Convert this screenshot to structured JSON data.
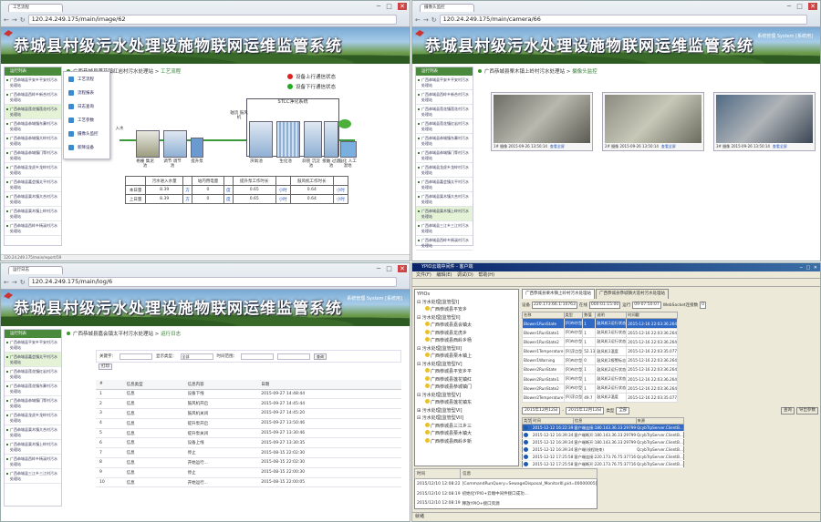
{
  "q1": {
    "tab_title": "工艺流程",
    "url": "120.24.249.175/main/image/62",
    "banner_title": "恭城县村级污水处理设施物联网运维监管系统",
    "side_head": "运行列表",
    "side_items": [
      "广西恭城县平安乡平安村污水处理站",
      "广西恭城县西岭乡新合村污水处理站",
      "广西恭城县莲花镇莲花村污水处理站",
      "广西恭城县恭城镇东寨村污水处理站",
      "广西恭城县恭城镇大岭村污水处理站",
      "广西恭城县恭城镇门等村污水处理站",
      "广西恭城县龙虎乡龙岭村污水处理站",
      "广西恭城县嘉会镇太平村污水处理站",
      "广西恭城县栗木镇大合村污水处理站",
      "广西恭城县栗木镇上岭村污水处理站",
      "广西恭城县西岭乡杨溪村污水处理站"
    ],
    "crumb_site": "广西恭城县莲花镇红岩村污水处理站",
    "crumb_sep": " > ",
    "crumb_page": "工艺流程",
    "menu": [
      "工艺流程",
      "流程报表",
      "日志查询",
      "工艺参数",
      "摄像头监控",
      "新降设备"
    ],
    "legend_up": "设备上行通信状态",
    "legend_down": "设备下行通信状态",
    "stcc": "STCC净化系统",
    "blower": "轴流 鼓风机",
    "inlet": "入水",
    "labels": [
      "格栅 集泥池",
      "调节 调节池",
      "提升泵",
      "厌氧池",
      "生化池",
      "斜管 沉淀池",
      "接触 过滤池",
      "强化 人工湿地"
    ],
    "table": {
      "head": [
        "",
        "污水进入水量",
        "",
        "站内用电量",
        "",
        "提升泵工作时长",
        "",
        "鼓风机工作时长",
        ""
      ],
      "rows": [
        [
          "本日量",
          "8.39",
          "方",
          "0",
          "度",
          "0.65",
          "小时",
          "0.64",
          "小时"
        ],
        [
          "上日量",
          "8.39",
          "方",
          "0",
          "度",
          "0.65",
          "小时",
          "0.64",
          "小时"
        ]
      ]
    },
    "status": "120.24.249.175/main/report/59"
  },
  "q2": {
    "tab_title": "摄像头监控",
    "url": "120.24.249.175/main/camera/66",
    "banner_title": "恭城县村级污水处理设施物联网运维监管系统",
    "links": "系统管理    System [系统用]",
    "side_head": "运行列表",
    "side_items": [
      "广西恭城县平安乡平安村污水处理站",
      "广西恭城县西岭乡新合村污水处理站",
      "广西恭城县莲花镇莲花村污水处理站",
      "广西恭城县莲花镇红岩村污水处理站",
      "广西恭城县恭城镇东寨村污水处理站",
      "广西恭城县恭城镇门等村污水处理站",
      "广西恭城县龙虎乡龙岭村污水处理站",
      "广西恭城县嘉会镇太平村污水处理站",
      "广西恭城县栗木镇大合村污水处理站",
      "广西恭城县栗木镇上岭村污水处理站",
      "广西恭城县三江乡三江村污水处理站",
      "广西恭城县西岭乡杨溪村污水处理站"
    ],
    "crumb_site": "广西恭城县栗木镇上岭村污水处理站",
    "crumb_sep": " > ",
    "crumb_page": "摄像头监控",
    "cams": [
      {
        "cap": "1# 摄像 2015-09-26 13:50:14",
        "link": "查看全屏"
      },
      {
        "cap": "2# 摄像 2015-09-26 13:50:14",
        "link": "查看全屏"
      },
      {
        "cap": "3# 摄像 2015-09-26 13:50:14",
        "link": "查看全屏"
      }
    ]
  },
  "q3": {
    "tab_title": "运行日志",
    "url": "120.24.249.175/main/log/6",
    "banner_title": "恭城县村级污水处理设施物联网运维监管系统",
    "links": "系统管理    System [系统用]",
    "side_head": "运行列表",
    "side_items": [
      "广西恭城县平安乡平安村污水处理站",
      "广西恭城县嘉会镇太平村污水处理站",
      "广西恭城县莲花镇红岩村污水处理站",
      "广西恭城县莲花镇东寨村污水处理站",
      "广西恭城县恭城镇门等村污水处理站",
      "广西恭城县龙虎乡龙岭村污水处理站",
      "广西恭城县栗木镇大合村污水处理站",
      "广西恭城县栗木镇上岭村污水处理站",
      "广西恭城县西岭乡杨溪村污水处理站",
      "广西恭城县三江乡三江村污水处理站"
    ],
    "crumb_site": "广西恭城县嘉会镇太平村污水处理站",
    "crumb_sep": " > ",
    "crumb_page": "运行日志",
    "toolbar": {
      "key": "关键字：",
      "type": "显示类型：",
      "type_val": "全部",
      "range": "时间范围：",
      "query": "查询",
      "print": "打印"
    },
    "cols": [
      "#",
      "信息类型",
      "信息内容",
      "日期"
    ],
    "rows": [
      [
        "1",
        "信息",
        "设备下线",
        "2015-09-27 14:48:44"
      ],
      [
        "2",
        "信息",
        "鼓风机开启",
        "2015-09-27 14:45:44"
      ],
      [
        "3",
        "信息",
        "鼓风机关闭",
        "2015-09-27 14:45:20"
      ],
      [
        "4",
        "信息",
        "提升泵开启",
        "2015-09-27 13:50:46"
      ],
      [
        "5",
        "信息",
        "提升泵关闭",
        "2015-09-27 13:30:46"
      ],
      [
        "6",
        "信息",
        "设备上线",
        "2015-09-27 13:30:35"
      ],
      [
        "7",
        "信息",
        "停止",
        "2015-08-15 22:02:30"
      ],
      [
        "8",
        "信息",
        "开始运行...",
        "2015-08-15 22:02:30"
      ],
      [
        "9",
        "信息",
        "停止",
        "2015-08-15 22:00:30"
      ],
      [
        "10",
        "信息",
        "开始运行...",
        "2015-08-15 22:00:05"
      ]
    ]
  },
  "q4": {
    "title": "YPIO云端中间件 - 客户端",
    "menu": "文件(F)  编辑(E)  调试(D)  帮助(H)",
    "tree": [
      {
        "lvl": 0,
        "t": "YPIOs"
      },
      {
        "lvl": 0,
        "t": "⊟ 污水处理[监管型I]"
      },
      {
        "lvl": 1,
        "t": "广西恭城县平安乡"
      },
      {
        "lvl": 0,
        "t": "⊟ 污水处理[监管型II]"
      },
      {
        "lvl": 1,
        "t": "广西恭城县嘉会镇太"
      },
      {
        "lvl": 1,
        "t": "广西恭城县龙虎乡"
      },
      {
        "lvl": 1,
        "t": "广西恭城县西岭乡杨"
      },
      {
        "lvl": 0,
        "t": "⊟ 污水处理[监管型III]"
      },
      {
        "lvl": 1,
        "t": "广西恭城县栗木镇上"
      },
      {
        "lvl": 0,
        "t": "⊟ 污水处理[监管型IV]"
      },
      {
        "lvl": 1,
        "t": "广西恭城县平安乡平"
      },
      {
        "lvl": 1,
        "t": "广西恭城县莲花镇红"
      },
      {
        "lvl": 1,
        "t": "广西恭城县恭城镇门"
      },
      {
        "lvl": 0,
        "t": "⊟ 污水处理[监管型V]"
      },
      {
        "lvl": 1,
        "t": "广西恭城县莲花镇东"
      },
      {
        "lvl": 0,
        "t": "⊞ 污水处理[监管型VI]"
      },
      {
        "lvl": 0,
        "t": "⊟ 污水处理[监管型VII]"
      },
      {
        "lvl": 1,
        "t": "广西恭城县三江乡三"
      },
      {
        "lvl": 1,
        "t": "广西恭城县栗木镇大"
      },
      {
        "lvl": 1,
        "t": "广西恭城县西岭乡新"
      }
    ],
    "tabs": [
      "广西恭城县栗木镇上岭村污水处理站",
      "广西恭城县恭城镇大莲村污水处理站"
    ],
    "fields": {
      "dev_l": "设备",
      "dev": "220.173.66.1:10763",
      "online_l": "在线",
      "online": "000:01:15:00",
      "run_l": "运行",
      "run": "09-07:50:07",
      "ws_l": "WebSocket连接数",
      "ws": "0"
    },
    "grid_cols": [
      "名称",
      "类型",
      "数值",
      "说明",
      "时间戳"
    ],
    "grid_rows": [
      [
        "Blower1RunState",
        "[R]布尔型",
        "1",
        "鼓风机1运行状态",
        "2015-12-16 22:03:36.264"
      ],
      [
        "Blower1RunState1",
        "[R]布尔型",
        "1",
        "鼓风机1运行状态",
        "2015-12-16 22:03:36.264"
      ],
      [
        "Blower1RunState2",
        "[R]布尔型",
        "1",
        "鼓风机1运行状态",
        "2015-12-16 22:03:36.264"
      ],
      [
        "Blower1Temperature",
        "[R]浮点型",
        "52.13",
        "鼓风机1温度",
        "2015-12-16 22:03:35.077"
      ],
      [
        "Blower1Warning",
        "[R]布尔型",
        "0",
        "鼓风机1报警标志",
        "2015-12-16 22:03:36.264"
      ],
      [
        "Blower2RunState",
        "[R]布尔型",
        "1",
        "鼓风机2运行状态",
        "2015-12-16 22:03:36.264"
      ],
      [
        "Blower2RunState1",
        "[R]布尔型",
        "1",
        "鼓风机2运行状态",
        "2015-12-16 22:03:36.264"
      ],
      [
        "Blower2RunState2",
        "[R]布尔型",
        "1",
        "鼓风机2运行状态",
        "2015-12-16 22:03:36.264"
      ],
      [
        "Blower2Temperature",
        "[R]浮点型",
        "49.7",
        "鼓风机2温度",
        "2015-12-16 22:03:35.077"
      ]
    ],
    "filter": {
      "from": "2015年12月12日",
      "to": "2015年12月12日",
      "type_l": "类型",
      "type": "全部",
      "query": "查询",
      "export": "导出参数"
    },
    "msg_cols": [
      "类型",
      "时间",
      "信息",
      "来源"
    ],
    "msg_rows": [
      [
        "2015-12-12 16:22:39",
        "客户端连接:180.143.36.33:29799",
        "QcybTrpServer.ClientB..."
      ],
      [
        "2015-12-12 16:39:34",
        "客户端断开:180.143.36.33:29799",
        "QcybTrpServer.ClientB..."
      ],
      [
        "2015-12-12 16:39:34",
        "客户端断开:180.143.36.33:29799",
        "QcybTrpServer.ClientB..."
      ],
      [
        "2015-12-12 16:39:34",
        "客户端(线程结束)",
        "QcybTrpServer.ClientB..."
      ],
      [
        "2015-12-12 17:25:58",
        "客户端连接:220.173.76.75:37716",
        "QcybTrpServer.ClientB..."
      ],
      [
        "2015-12-12 17:25:58",
        "客户端断开:220.173.76.75:37716",
        "QcybTrpServer.ClientB..."
      ]
    ],
    "log_cols": [
      "时间",
      "信息"
    ],
    "log_rows": [
      [
        "2015/12/10 12:08:22",
        "[CommandRunQuery=SewageDisposal_MonitorIII,pid=00000005]"
      ],
      [
        "2015/12/10 12:08:19",
        "初始化YPIO+云端中间件接口成功..."
      ],
      [
        "2015/12/10 12:08:19",
        "释放YPIO+接口资源"
      ]
    ],
    "status": "就绪"
  }
}
